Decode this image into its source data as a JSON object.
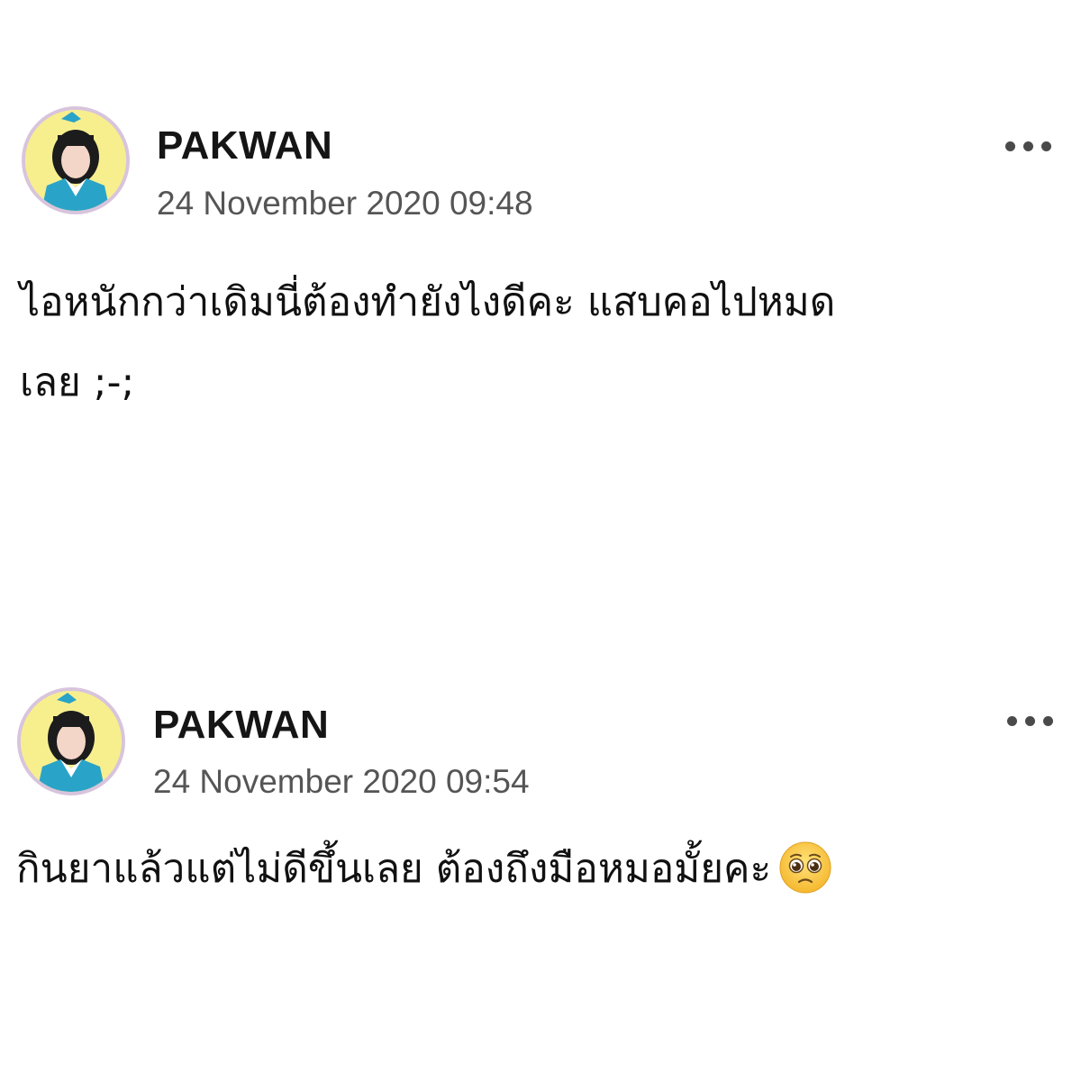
{
  "posts": [
    {
      "author": "PAKWAN",
      "timestamp": "24 November 2020 09:48",
      "lines": [
        "ไอหนักกว่าเดิมนี่ต้องทำยังไงดีคะ แสบคอไปหมด",
        "เลย ;-;"
      ],
      "more_icon": "more-horizontal-icon",
      "avatar_icon": "user-avatar"
    },
    {
      "author": "PAKWAN",
      "timestamp": "24 November 2020 09:54",
      "lines": [
        "กินยาแล้วแต่ไม่ดีขึ้นเลย ต้องถึงมือหมอมั้ยคะ"
      ],
      "emoji": "pleading-face-emoji",
      "more_icon": "more-horizontal-icon",
      "avatar_icon": "user-avatar"
    }
  ],
  "colors": {
    "background": "#ffffff",
    "author": "#151515",
    "timestamp": "#555555",
    "avatar_ring": "#d8c4dc",
    "avatar_bg": "#f7ef8e",
    "avatar_outfit": "#2aa3c8"
  }
}
